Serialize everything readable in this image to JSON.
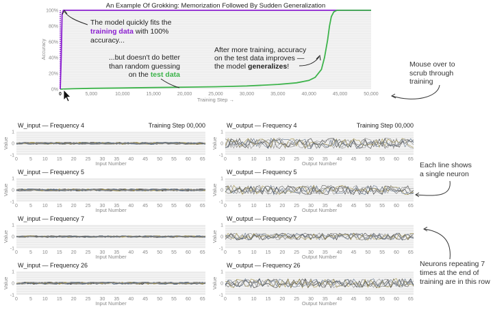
{
  "chart_data": [
    {
      "type": "line",
      "title": "An Example Of Grokking: Memorization Followed By Sudden Generalization",
      "xlabel": "Training Step →",
      "ylabel": "Accuracy",
      "xlim": [
        0,
        50000
      ],
      "ylim": [
        0,
        100
      ],
      "x_ticks": [
        "0",
        "5,000",
        "10,000",
        "15,000",
        "20,000",
        "25,000",
        "30,000",
        "35,000",
        "40,000",
        "45,000",
        "50,000"
      ],
      "y_ticks": [
        "0%",
        "20%",
        "40%",
        "60%",
        "80%",
        "100%"
      ],
      "series": [
        {
          "name": "training data",
          "color": "#8b1fd0",
          "x": [
            0,
            150,
            300,
            500,
            50000
          ],
          "y": [
            0,
            40,
            95,
            100,
            100
          ]
        },
        {
          "name": "test data",
          "color": "#3cb34a",
          "x": [
            0,
            2000,
            5000,
            10000,
            15000,
            20000,
            25000,
            30000,
            35000,
            38000,
            40000,
            41000,
            42000,
            42500,
            43000,
            43300,
            43600,
            44000,
            44500,
            50000
          ],
          "y": [
            0,
            0.5,
            1,
            1.5,
            2,
            2.5,
            3,
            4,
            6,
            8,
            11,
            15,
            25,
            40,
            62,
            80,
            92,
            98,
            100,
            100
          ]
        }
      ],
      "annotations": {
        "train_pre": "The model quickly fits the",
        "train_hl": "training data",
        "train_post": " with 100%",
        "train_line3": "accuracy...",
        "test_line1": "...but doesn't do better",
        "test_line2": "than random guessing",
        "test_pre": "on the ",
        "test_hl": "test data",
        "gen_line1": "After more training, accuracy",
        "gen_line2": "on the test data improves —",
        "gen_pre": "the model ",
        "gen_hl": "generalizes",
        "gen_post": "!"
      }
    },
    {
      "type": "line",
      "panels": [
        {
          "title": "W_input — Frequency 4",
          "step_label": "Training Step 00,000",
          "xlabel": "Input Number",
          "ylabel": "Value",
          "amp": 0.08
        },
        {
          "title": "W_output — Frequency 4",
          "step_label": "Training Step 00,000",
          "xlabel": "Output Number",
          "ylabel": "Value",
          "amp": 0.45
        },
        {
          "title": "W_input — Frequency 5",
          "step_label": "",
          "xlabel": "Input Number",
          "ylabel": "Value",
          "amp": 0.08
        },
        {
          "title": "W_output — Frequency 5",
          "step_label": "",
          "xlabel": "Output Number",
          "ylabel": "Value",
          "amp": 0.4
        },
        {
          "title": "W_input — Frequency 7",
          "step_label": "",
          "xlabel": "Input Number",
          "ylabel": "Value",
          "amp": 0.06
        },
        {
          "title": "W_output — Frequency 7",
          "step_label": "",
          "xlabel": "Output Number",
          "ylabel": "Value",
          "amp": 0.3
        },
        {
          "title": "W_input — Frequency 26",
          "step_label": "",
          "xlabel": "Input Number",
          "ylabel": "Value",
          "amp": 0.08
        },
        {
          "title": "W_output — Frequency 26",
          "step_label": "",
          "xlabel": "Output Number",
          "ylabel": "Value",
          "amp": 0.4
        }
      ],
      "xlim": [
        0,
        66
      ],
      "ylim": [
        -1,
        1
      ],
      "x_ticks": [
        "0",
        "5",
        "10",
        "15",
        "20",
        "25",
        "30",
        "35",
        "40",
        "45",
        "50",
        "55",
        "60",
        "65"
      ],
      "y_ticks": [
        "-1",
        "0",
        "1"
      ],
      "neuron_count": 6
    }
  ],
  "side_notes": {
    "scrub": [
      "Mouse over to",
      "scrub through",
      "training"
    ],
    "neuron": [
      "Each line shows",
      "a single neuron"
    ],
    "repeat": [
      "Neurons repeating 7",
      "times at the end of",
      "training are in this row"
    ]
  }
}
